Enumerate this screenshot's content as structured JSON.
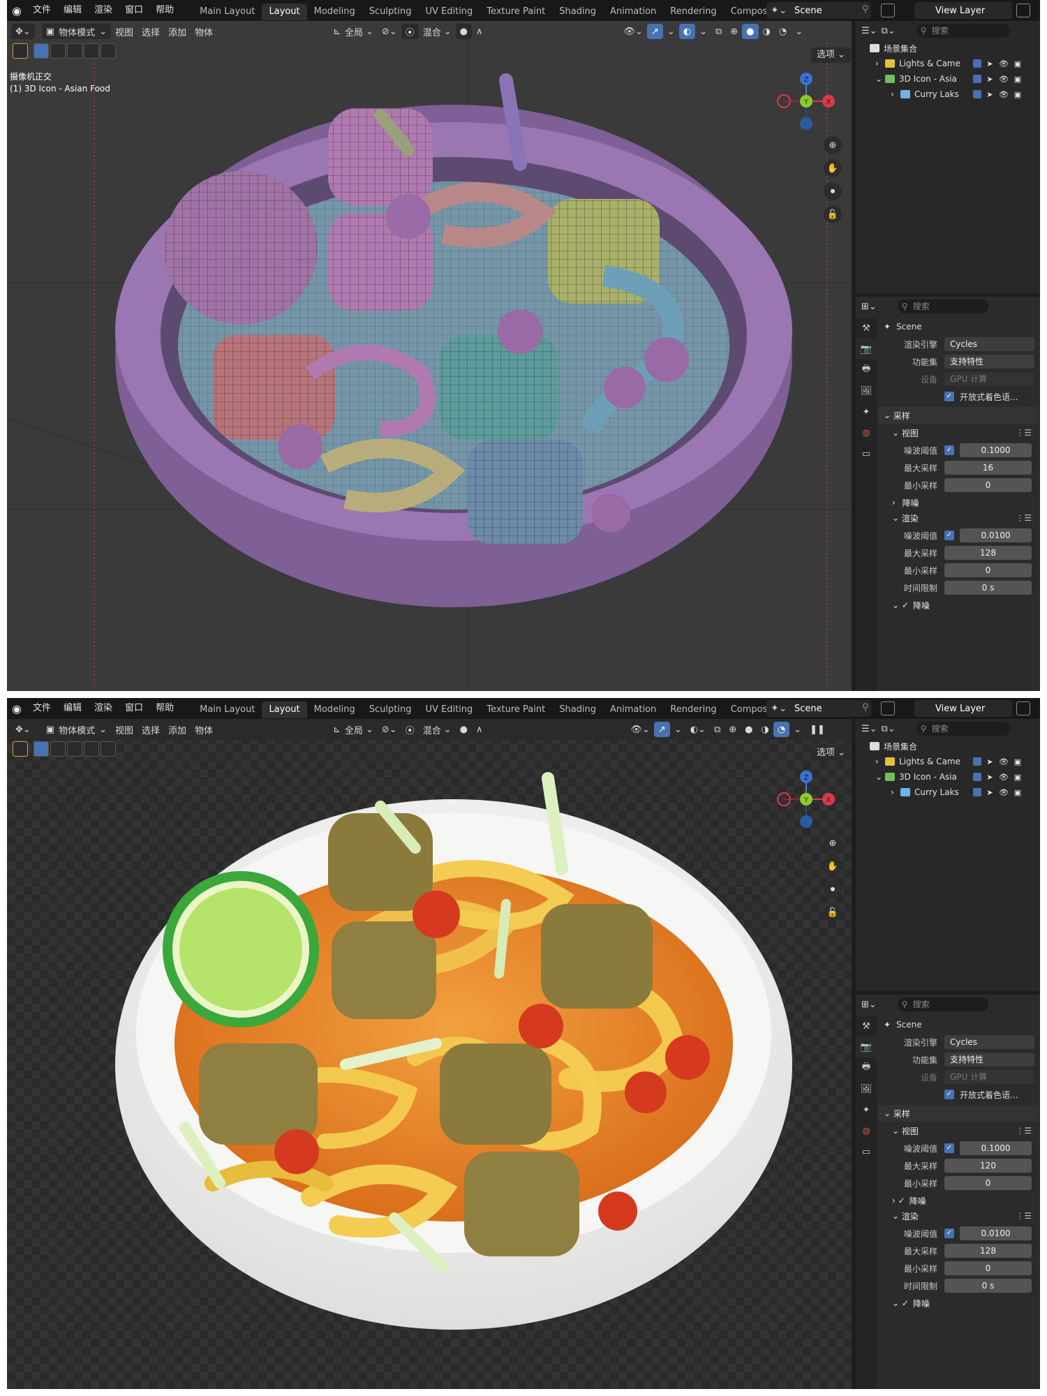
{
  "menu": {
    "items": [
      "文件",
      "编辑",
      "渲染",
      "窗口",
      "帮助"
    ],
    "workspaces": [
      "Main Layout",
      "Layout",
      "Modeling",
      "Sculpting",
      "UV Editing",
      "Texture Paint",
      "Shading",
      "Animation",
      "Rendering",
      "Compositir"
    ],
    "active_workspace": "Layout",
    "scene": "Scene",
    "view_layer": "View Layer"
  },
  "viewport": {
    "mode": "物体模式",
    "menus": [
      "视图",
      "选择",
      "添加",
      "物体"
    ],
    "transform": "全局",
    "snap": "混合",
    "options": "选项",
    "info_line1": "摄像机正交",
    "info_line2": "(1) 3D Icon - Asian Food",
    "gizmo": {
      "z": "Z",
      "y": "Y",
      "x": "X"
    }
  },
  "outliner": {
    "search_placeholder": "搜索",
    "root": "场景集合",
    "rows": [
      {
        "label": "Lights & Came",
        "color": "#e3c23a"
      },
      {
        "label": "3D Icon - Asia",
        "color": "#6fbf5a"
      },
      {
        "label": "Curry Laks",
        "color": "#6fb3e8"
      }
    ]
  },
  "top_props": {
    "search_placeholder": "搜索",
    "scene_label": "Scene",
    "engine_label": "渲染引擎",
    "engine_value": "Cycles",
    "feature_label": "功能集",
    "feature_value": "支持特性",
    "device_label": "设备",
    "device_value": "GPU 计算",
    "osl_label": "开放式着色语...",
    "sampling": "采样",
    "viewport_sec": "视图",
    "vp_noise_label": "噪波阈值",
    "vp_noise": "0.1000",
    "vp_max_label": "最大采样",
    "vp_max": "16",
    "vp_min_label": "最小采样",
    "vp_min": "0",
    "vp_denoise": "降噪",
    "render_sec": "渲染",
    "r_noise_label": "噪波阈值",
    "r_noise": "0.0100",
    "r_max_label": "最大采样",
    "r_max": "128",
    "r_min_label": "最小采样",
    "r_min": "0",
    "r_time_label": "时间限制",
    "r_time": "0 s",
    "r_denoise": "降噪"
  },
  "bottom_props": {
    "search_placeholder": "搜索",
    "scene_label": "Scene",
    "engine_label": "渲染引擎",
    "engine_value": "Cycles",
    "feature_label": "功能集",
    "feature_value": "支持特性",
    "device_label": "设备",
    "device_value": "GPU 计算",
    "osl_label": "开放式着色语...",
    "sampling": "采样",
    "viewport_sec": "视图",
    "vp_noise_label": "噪波阈值",
    "vp_noise": "0.1000",
    "vp_max_label": "最大采样",
    "vp_max": "120",
    "vp_min_label": "最小采样",
    "vp_min": "0",
    "vp_denoise": "降噪",
    "render_sec": "渲染",
    "r_noise_label": "噪波阈值",
    "r_noise": "0.0100",
    "r_max_label": "最大采样",
    "r_max": "128",
    "r_min_label": "最小采样",
    "r_min": "0",
    "r_time_label": "时间限制",
    "r_time": "0 s",
    "r_denoise": "降噪"
  },
  "colors": {
    "accent_blue": "#4772b3",
    "bowl_wire": "#9a76b3",
    "bowl_render": "#f4f4f2",
    "broth": "#e58a2a",
    "noodle": "#f2c94c",
    "lime": "#9ad94a",
    "meat": "#8a7a3c",
    "tomato": "#d63a1e"
  }
}
